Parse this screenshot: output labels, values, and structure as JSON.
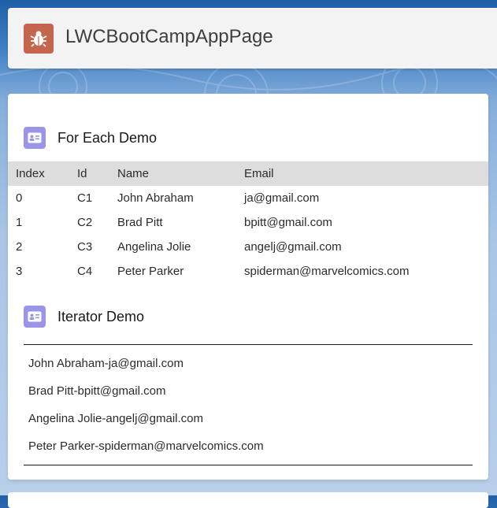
{
  "app": {
    "title": "LWCBootCampAppPage",
    "icon": "bug-icon",
    "icon_color": "#c3664d"
  },
  "for_each": {
    "title": "For Each Demo",
    "icon": "contact-card-icon",
    "columns": [
      "Index",
      "Id",
      "Name",
      "Email"
    ],
    "rows": [
      [
        "0",
        "C1",
        "John Abraham",
        "ja@gmail.com"
      ],
      [
        "1",
        "C2",
        "Brad Pitt",
        "bpitt@gmail.com"
      ],
      [
        "2",
        "C3",
        "Angelina Jolie",
        "angelj@gmail.com"
      ],
      [
        "3",
        "C4",
        "Peter Parker",
        "spiderman@marvelcomics.com"
      ]
    ]
  },
  "iterator": {
    "title": "Iterator Demo",
    "icon": "contact-card-icon",
    "items": [
      "John Abraham-ja@gmail.com",
      "Brad Pitt-bpitt@gmail.com",
      "Angelina Jolie-angelj@gmail.com",
      "Peter Parker-spiderman@marvelcomics.com"
    ]
  },
  "colors": {
    "section_icon": "#9b95e8",
    "table_header": "#dddddd"
  }
}
